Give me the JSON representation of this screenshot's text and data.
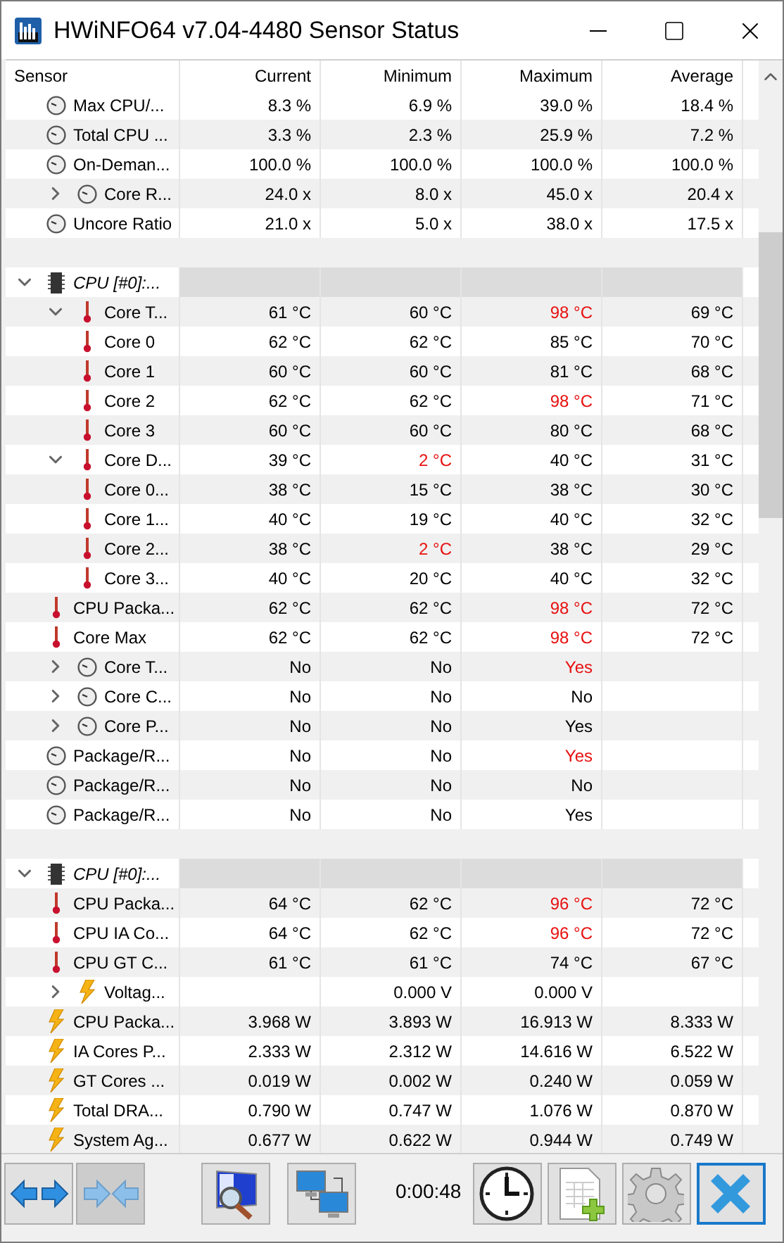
{
  "window": {
    "title": "HWiNFO64 v7.04-4480 Sensor Status"
  },
  "columns": [
    "Sensor",
    "Current",
    "Minimum",
    "Maximum",
    "Average"
  ],
  "rows": [
    {
      "kind": "clock",
      "label": "Max CPU/...",
      "current": "8.3 %",
      "minimum": "6.9 %",
      "maximum": "39.0 %",
      "average": "18.4 %",
      "alert_min": false,
      "alert_max": false
    },
    {
      "kind": "clock",
      "label": "Total CPU ...",
      "current": "3.3 %",
      "minimum": "2.3 %",
      "maximum": "25.9 %",
      "average": "7.2 %",
      "alert_min": false,
      "alert_max": false
    },
    {
      "kind": "clock",
      "label": "On-Deman...",
      "current": "100.0 %",
      "minimum": "100.0 %",
      "maximum": "100.0 %",
      "average": "100.0 %",
      "alert_min": false,
      "alert_max": false
    },
    {
      "kind": "clock",
      "label": "Core R...",
      "expanded": false,
      "current": "24.0 x",
      "minimum": "8.0 x",
      "maximum": "45.0 x",
      "average": "20.4 x",
      "alert_min": false,
      "alert_max": false
    },
    {
      "kind": "clock",
      "label": "Uncore Ratio",
      "current": "21.0 x",
      "minimum": "5.0 x",
      "maximum": "38.0 x",
      "average": "17.5 x",
      "alert_min": false,
      "alert_max": false
    },
    {
      "kind": "spacer"
    },
    {
      "kind": "group",
      "label": "CPU [#0]:...",
      "expanded": true,
      "children": [
        {
          "kind": "thermo",
          "label": "Core T...",
          "expanded": true,
          "current": "61 °C",
          "minimum": "60 °C",
          "maximum": "98 °C",
          "average": "69 °C",
          "alert_min": false,
          "alert_max": true,
          "children": [
            {
              "kind": "thermo",
              "label": "Core 0",
              "current": "62 °C",
              "minimum": "62 °C",
              "maximum": "85 °C",
              "average": "70 °C",
              "alert_min": false,
              "alert_max": false
            },
            {
              "kind": "thermo",
              "label": "Core 1",
              "current": "60 °C",
              "minimum": "60 °C",
              "maximum": "81 °C",
              "average": "68 °C",
              "alert_min": false,
              "alert_max": false
            },
            {
              "kind": "thermo",
              "label": "Core 2",
              "current": "62 °C",
              "minimum": "62 °C",
              "maximum": "98 °C",
              "average": "71 °C",
              "alert_min": false,
              "alert_max": true
            },
            {
              "kind": "thermo",
              "label": "Core 3",
              "current": "60 °C",
              "minimum": "60 °C",
              "maximum": "80 °C",
              "average": "68 °C",
              "alert_min": false,
              "alert_max": false
            }
          ]
        },
        {
          "kind": "thermo",
          "label": "Core D...",
          "expanded": true,
          "current": "39 °C",
          "minimum": "2 °C",
          "maximum": "40 °C",
          "average": "31 °C",
          "alert_min": true,
          "alert_max": false,
          "children": [
            {
              "kind": "thermo",
              "label": "Core 0...",
              "current": "38 °C",
              "minimum": "15 °C",
              "maximum": "38 °C",
              "average": "30 °C",
              "alert_min": false,
              "alert_max": false
            },
            {
              "kind": "thermo",
              "label": "Core 1...",
              "current": "40 °C",
              "minimum": "19 °C",
              "maximum": "40 °C",
              "average": "32 °C",
              "alert_min": false,
              "alert_max": false
            },
            {
              "kind": "thermo",
              "label": "Core 2...",
              "current": "38 °C",
              "minimum": "2 °C",
              "maximum": "38 °C",
              "average": "29 °C",
              "alert_min": true,
              "alert_max": false
            },
            {
              "kind": "thermo",
              "label": "Core 3...",
              "current": "40 °C",
              "minimum": "20 °C",
              "maximum": "40 °C",
              "average": "32 °C",
              "alert_min": false,
              "alert_max": false
            }
          ]
        },
        {
          "kind": "thermo",
          "label": "CPU Packa...",
          "current": "62 °C",
          "minimum": "62 °C",
          "maximum": "98 °C",
          "average": "72 °C",
          "alert_min": false,
          "alert_max": true
        },
        {
          "kind": "thermo",
          "label": "Core Max",
          "current": "62 °C",
          "minimum": "62 °C",
          "maximum": "98 °C",
          "average": "72 °C",
          "alert_min": false,
          "alert_max": true
        },
        {
          "kind": "clock",
          "label": "Core T...",
          "expanded": false,
          "current": "No",
          "minimum": "No",
          "maximum": "Yes",
          "alert_min": false,
          "alert_max": true
        },
        {
          "kind": "clock",
          "label": "Core C...",
          "expanded": false,
          "current": "No",
          "minimum": "No",
          "maximum": "No",
          "alert_min": false,
          "alert_max": false
        },
        {
          "kind": "clock",
          "label": "Core P...",
          "expanded": false,
          "current": "No",
          "minimum": "No",
          "maximum": "Yes",
          "alert_min": false,
          "alert_max": false
        },
        {
          "kind": "clock",
          "label": "Package/R...",
          "current": "No",
          "minimum": "No",
          "maximum": "Yes",
          "alert_min": false,
          "alert_max": true
        },
        {
          "kind": "clock",
          "label": "Package/R...",
          "current": "No",
          "minimum": "No",
          "maximum": "No",
          "alert_min": false,
          "alert_max": false
        },
        {
          "kind": "clock",
          "label": "Package/R...",
          "current": "No",
          "minimum": "No",
          "maximum": "Yes",
          "alert_min": false,
          "alert_max": false
        }
      ]
    },
    {
      "kind": "spacer"
    },
    {
      "kind": "group",
      "label": "CPU [#0]:...",
      "expanded": true,
      "children": [
        {
          "kind": "thermo",
          "label": "CPU Packa...",
          "current": "64 °C",
          "minimum": "62 °C",
          "maximum": "96 °C",
          "average": "72 °C",
          "alert_min": false,
          "alert_max": true
        },
        {
          "kind": "thermo",
          "label": "CPU IA Co...",
          "current": "64 °C",
          "minimum": "62 °C",
          "maximum": "96 °C",
          "average": "72 °C",
          "alert_min": false,
          "alert_max": true
        },
        {
          "kind": "thermo",
          "label": "CPU GT C...",
          "current": "61 °C",
          "minimum": "61 °C",
          "maximum": "74 °C",
          "average": "67 °C",
          "alert_min": false,
          "alert_max": false
        },
        {
          "kind": "bolt",
          "label": "Voltag...",
          "expanded": false,
          "minimum": "0.000 V",
          "maximum": "0.000 V",
          "alert_min": false,
          "alert_max": false
        },
        {
          "kind": "bolt",
          "label": "CPU Packa...",
          "current": "3.968 W",
          "minimum": "3.893 W",
          "maximum": "16.913 W",
          "average": "8.333 W",
          "alert_min": false,
          "alert_max": false
        },
        {
          "kind": "bolt",
          "label": "IA Cores P...",
          "current": "2.333 W",
          "minimum": "2.312 W",
          "maximum": "14.616 W",
          "average": "6.522 W",
          "alert_min": false,
          "alert_max": false
        },
        {
          "kind": "bolt",
          "label": "GT Cores ...",
          "current": "0.019 W",
          "minimum": "0.002 W",
          "maximum": "0.240 W",
          "average": "0.059 W",
          "alert_min": false,
          "alert_max": false
        },
        {
          "kind": "bolt",
          "label": "Total DRA...",
          "current": "0.790 W",
          "minimum": "0.747 W",
          "maximum": "1.076 W",
          "average": "0.870 W",
          "alert_min": false,
          "alert_max": false
        },
        {
          "kind": "bolt",
          "label": "System Ag...",
          "current": "0.677 W",
          "minimum": "0.622 W",
          "maximum": "0.944 W",
          "average": "0.749 W",
          "alert_min": false,
          "alert_max": false
        }
      ]
    }
  ],
  "toolbar": [
    {
      "kind": "expand",
      "disabled": false,
      "focused": false
    },
    {
      "kind": "collapse",
      "disabled": true,
      "focused": false
    },
    {
      "kind": "monitor"
    },
    {
      "kind": "network"
    },
    {
      "kind": "timer",
      "text": "0:00:48"
    },
    {
      "kind": "clock",
      "disabled": false,
      "focused": false
    },
    {
      "kind": "report",
      "disabled": false,
      "focused": false
    },
    {
      "kind": "settings",
      "disabled": false,
      "focused": false
    },
    {
      "kind": "close",
      "disabled": false,
      "focused": true
    }
  ]
}
